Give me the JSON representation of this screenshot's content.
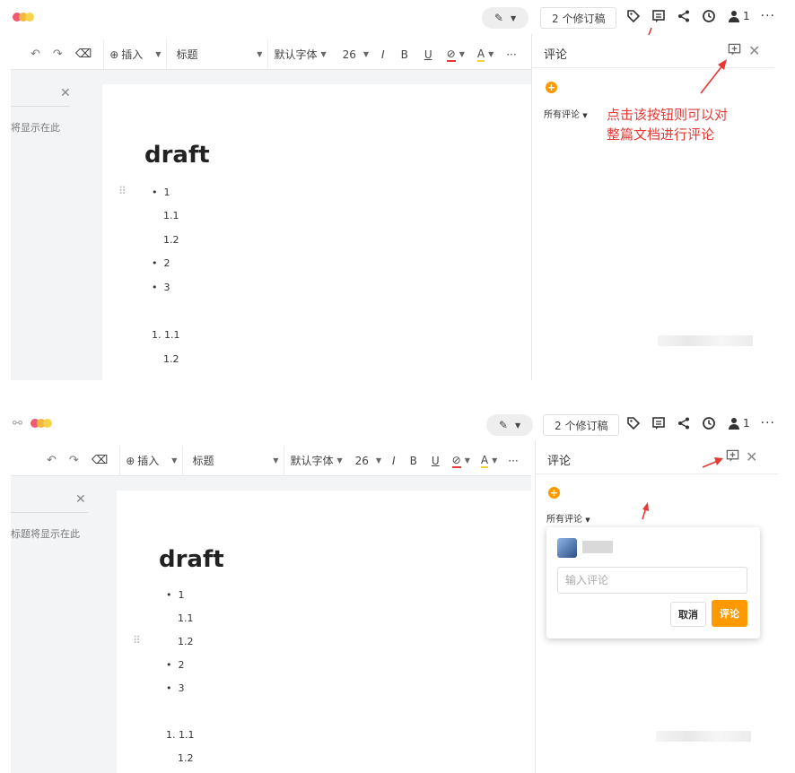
{
  "logo_colors": [
    "#ee5a6f",
    "#f4b63f",
    "#f7d34a"
  ],
  "accent_color": "#ff9900",
  "annotation_color": "#e53935",
  "topbar": {
    "revisions_label": "2 个修订稿",
    "collaborator_count": "1",
    "more_label": "···"
  },
  "toolbar": {
    "insert_label": "插入",
    "heading_label": "标题",
    "font_label": "默认字体",
    "font_size": "26",
    "italic": "I",
    "bold": "B",
    "underline": "U",
    "text_color": "A",
    "more": "···"
  },
  "outline": {
    "hint_top": "将显示在此",
    "hint_bottom": "标题将显示在此"
  },
  "document": {
    "title": "draft",
    "items": [
      {
        "marker": "•",
        "text": "1",
        "level": 0
      },
      {
        "marker": "",
        "text": "1.1",
        "level": 1
      },
      {
        "marker": "",
        "text": "1.2",
        "level": 1
      },
      {
        "marker": "•",
        "text": "2",
        "level": 0
      },
      {
        "marker": "•",
        "text": "3",
        "level": 0
      },
      {
        "marker": "1.",
        "text": "1.1",
        "level": 0
      },
      {
        "marker": "",
        "text": "1.2",
        "level": 1
      }
    ]
  },
  "comments": {
    "title": "评论",
    "filter_label": "所有评论",
    "input_placeholder": "输入评论",
    "cancel_label": "取消",
    "submit_label": "评论"
  },
  "annotation": {
    "line1": "点击该按钮则可以对",
    "line2": "整篇文档进行评论"
  }
}
